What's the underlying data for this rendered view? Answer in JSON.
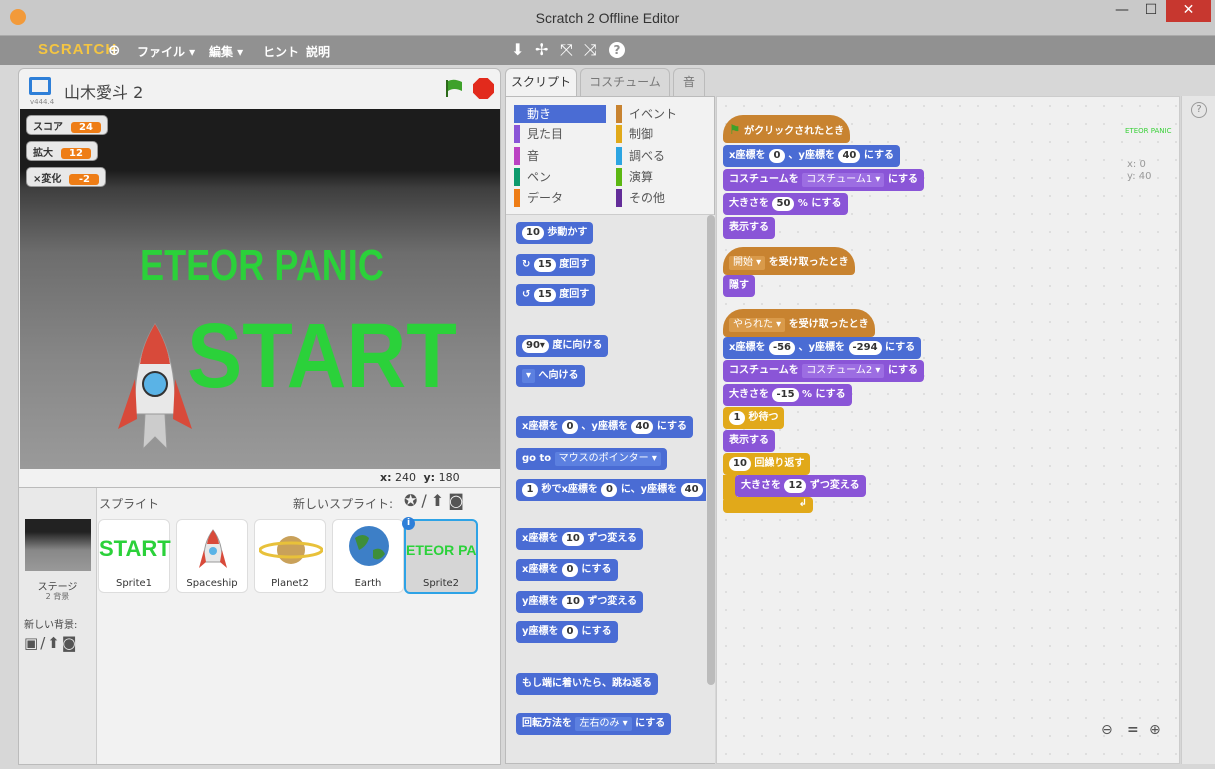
{
  "window": {
    "title": "Scratch 2 Offline Editor",
    "minimize": "—",
    "maximize": "☐",
    "close": "✕"
  },
  "menubar": {
    "logo": "SCRATCH",
    "globe": "⊕",
    "file": "ファイル ▾",
    "edit": "編集 ▾",
    "tips": "ヒント",
    "about": "説明",
    "tools": [
      "⬇",
      "✢",
      "⤧",
      "⤨",
      "?"
    ]
  },
  "stage": {
    "title": "山木愛斗 2",
    "version": "v444.4",
    "sprite_title": "ETEOR PANIC",
    "start_text": "START",
    "monitors": [
      {
        "label": "スコア",
        "value": "24"
      },
      {
        "label": "拡大",
        "value": "12"
      },
      {
        "label": "×変化",
        "value": "-2"
      }
    ],
    "x_label": "x:",
    "x_value": "240",
    "y_label": "y:",
    "y_value": "180"
  },
  "sprites": {
    "header": "スプライト",
    "new_sprite": "新しいスプライト:",
    "stage_label": "ステージ",
    "stage_sub": "2 背景",
    "new_backdrop": "新しい背景:",
    "items": [
      {
        "name": "Sprite1"
      },
      {
        "name": "Spaceship"
      },
      {
        "name": "Planet2"
      },
      {
        "name": "Earth"
      },
      {
        "name": "Sprite2"
      }
    ],
    "tile_start": "START",
    "tile_eteor": "ETEOR PANIC",
    "info": "i"
  },
  "tabs": {
    "scripts": "スクリプト",
    "costumes": "コスチューム",
    "sounds": "音"
  },
  "categories": {
    "motion": "動き",
    "looks": "見た目",
    "sound": "音",
    "pen": "ペン",
    "data": "データ",
    "events": "イベント",
    "control": "制御",
    "sensing": "調べる",
    "operators": "演算",
    "more": "その他",
    "colors": {
      "motion": "#4a6cd4",
      "looks": "#8a55d7",
      "sound": "#bb42c3",
      "pen": "#0e9a6c",
      "data": "#ee7d16",
      "events": "#c88330",
      "control": "#e1a91a",
      "sensing": "#2ca5e2",
      "operators": "#5cb712",
      "more": "#632d99"
    }
  },
  "palette_blocks": {
    "move_n": "10",
    "move_t": "歩動かす",
    "turn_r_n": "15",
    "turn_r_t": "度回す",
    "turn_l_n": "15",
    "turn_l_t": "度回す",
    "point_n": "90▾",
    "point_t": "度に向ける",
    "towards_d": "▾",
    "towards_t": "へ向ける",
    "goto_a": "x座標を",
    "goto_x": "0",
    "goto_b": "、y座標を",
    "goto_y": "40",
    "goto_c": "にする",
    "goto2_a": "go to",
    "goto2_d": "マウスのポインター ▾",
    "glide_n": "1",
    "glide_a": "秒でx座標を",
    "glide_x": "0",
    "glide_b": "に、y座標を",
    "glide_y": "40",
    "chx_a": "x座標を",
    "chx_n": "10",
    "chx_b": "ずつ変える",
    "setx_a": "x座標を",
    "setx_n": "0",
    "setx_b": "にする",
    "chy_a": "y座標を",
    "chy_n": "10",
    "chy_b": "ずつ変える",
    "sety_a": "y座標を",
    "sety_n": "0",
    "sety_b": "にする",
    "bounce": "もし端に着いたら、跳ね返る",
    "rot_a": "回転方法を",
    "rot_d": "左右のみ ▾",
    "rot_b": "にする"
  },
  "scripts": {
    "s1_hat": "がクリックされたとき",
    "s1_goto_a": "x座標を",
    "s1_goto_x": "0",
    "s1_goto_b": "、y座標を",
    "s1_goto_y": "40",
    "s1_goto_c": "にする",
    "s1_cos_a": "コスチュームを",
    "s1_cos_d": "コスチューム1 ▾",
    "s1_cos_b": "にする",
    "s1_size_a": "大きさを",
    "s1_size_n": "50",
    "s1_size_b": "% にする",
    "s1_show": "表示する",
    "s2_hat_d": "開始 ▾",
    "s2_hat": "を受け取ったとき",
    "s2_hide": "隠す",
    "s3_hat_d": "やられた ▾",
    "s3_hat": "を受け取ったとき",
    "s3_goto_a": "x座標を",
    "s3_goto_x": "-56",
    "s3_goto_b": "、y座標を",
    "s3_goto_y": "-294",
    "s3_goto_c": "にする",
    "s3_cos_a": "コスチュームを",
    "s3_cos_d": "コスチューム2 ▾",
    "s3_cos_b": "にする",
    "s3_size_a": "大きさを",
    "s3_size_n": "-15",
    "s3_size_b": "% にする",
    "s3_wait_n": "1",
    "s3_wait": "秒待つ",
    "s3_show": "表示する",
    "s3_rep_n": "10",
    "s3_rep": "回繰り返す",
    "s3_chsize_a": "大きさを",
    "s3_chsize_n": "12",
    "s3_chsize_b": "ずつ変える",
    "s3_loop": "↲"
  },
  "sprite_info": {
    "name": "ETEOR PANIC",
    "x": "x: 0",
    "y": "y: 40"
  },
  "zoom": {
    "out": "🔍−",
    "reset": "=",
    "in": "🔍+"
  },
  "help": "?"
}
